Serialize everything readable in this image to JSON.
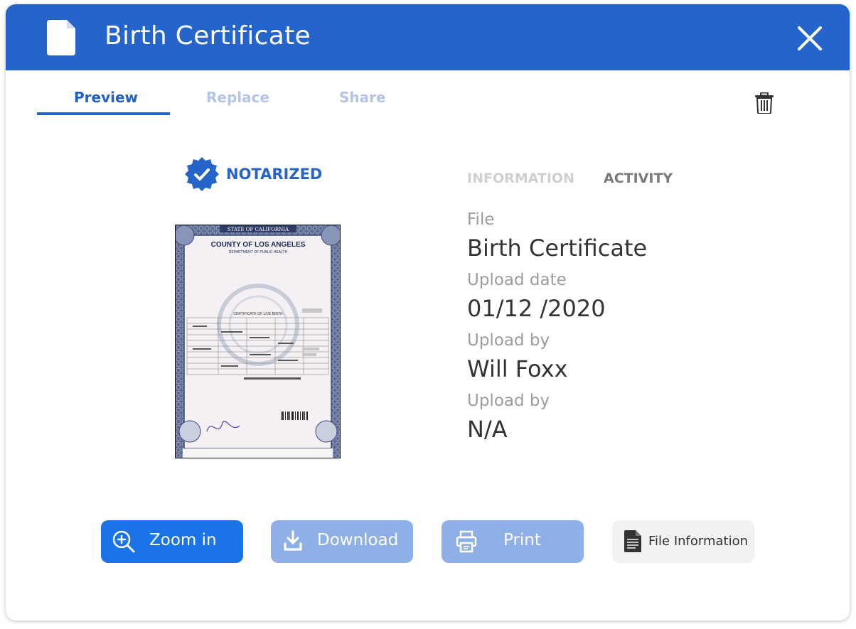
{
  "header": {
    "title": "Birth Certificate"
  },
  "tabs": [
    {
      "label": "Preview"
    },
    {
      "label": "Replace"
    },
    {
      "label": "Share"
    }
  ],
  "badge": {
    "label": "NOTARIZED"
  },
  "certificate_image": {
    "top_banner": "STATE OF CALIFORNIA",
    "county": "COUNTY OF LOS ANGELES",
    "department": "DEPARTMENT OF PUBLIC HEALTH",
    "form_title": "CERTIFICATE OF LIVE BIRTH"
  },
  "info_tabs": [
    {
      "label": "INFORMATION"
    },
    {
      "label": "ACTIVITY"
    }
  ],
  "fields": [
    {
      "label": "File",
      "value": "Birth Certificate"
    },
    {
      "label": "Upload date",
      "value": "01/12 /2020"
    },
    {
      "label": "Upload by",
      "value": "Will Foxx"
    },
    {
      "label": "Upload by",
      "value": "N/A"
    }
  ],
  "buttons": {
    "zoom": "Zoom in",
    "download": "Download",
    "print": "Print",
    "file_info": "File Information"
  },
  "colors": {
    "primary": "#2564ca",
    "button_primary": "#1a73e8",
    "button_disabled": "#8fb0e6",
    "tab_inactive": "#b4c4ea",
    "neutral_button": "#f2f2f2"
  }
}
